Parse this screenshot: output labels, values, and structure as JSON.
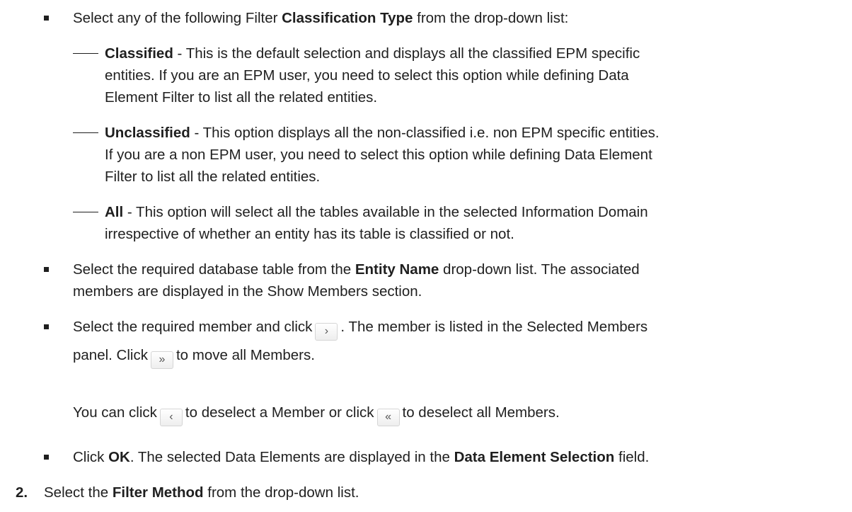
{
  "items": {
    "classification": {
      "pre": "Select any of the following Filter ",
      "bold": "Classification Type",
      "post": " from the drop-down list:"
    },
    "sub_classified": {
      "bold": "Classified",
      "line1": " - This is the default selection and displays all the classified EPM specific",
      "line2": "entities. If you are an EPM user, you need to select this option while defining Data",
      "line3": "Element Filter to list all the related entities."
    },
    "sub_unclassified": {
      "bold": "Unclassified",
      "line1": " - This option displays all the non-classified i.e. non EPM specific entities.",
      "line2": "If you are a non EPM user, you need to select this option while defining Data Element",
      "line3": "Filter to list all the related entities."
    },
    "sub_all": {
      "bold": "All",
      "line1": " - This option will select all the tables available in the selected Information Domain",
      "line2": "irrespective of whether an entity has its table is classified or not."
    },
    "entity": {
      "pre": "Select the required database table from the ",
      "bold": "Entity Name",
      "post": " drop-down list. The associated",
      "line2": "members are displayed in the Show Members section."
    },
    "member": {
      "pre": "Select the required member and click",
      "mid": ". The member is listed in the Selected Members",
      "line2_pre": "panel. Click",
      "line2_post": "to move all Members.",
      "line3_pre": "You can click",
      "line3_mid": "to deselect a Member or click",
      "line3_post": "to deselect all Members."
    },
    "ok": {
      "pre": "Click ",
      "bold": "OK",
      "mid": ". The selected Data Elements are displayed in the ",
      "bold2": "Data Element Selection",
      "post": " field."
    },
    "step2": {
      "number": "2.",
      "pre": "Select the ",
      "bold": "Filter Method",
      "post": " from the drop-down list."
    }
  },
  "buttons": {
    "move_one": "›",
    "move_all": "»",
    "remove_one": "‹",
    "remove_all": "«"
  }
}
